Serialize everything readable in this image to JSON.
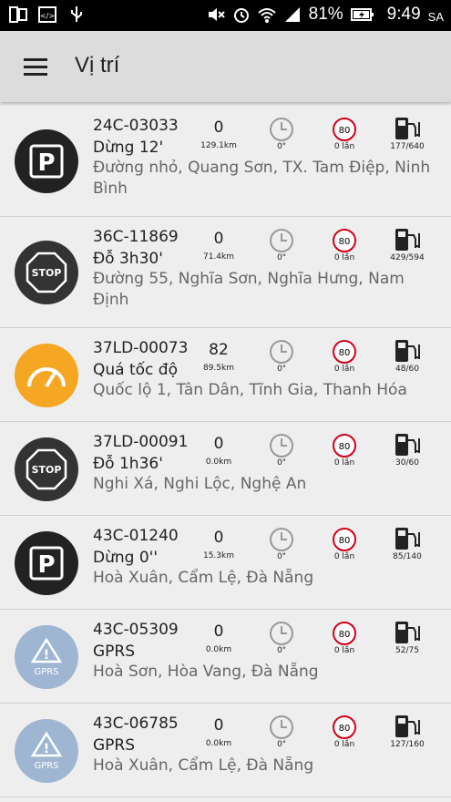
{
  "statusbar": {
    "battery": "81%",
    "time": "9:49",
    "ampm": "SA"
  },
  "appbar": {
    "title": "Vị trí"
  },
  "rows": [
    {
      "plate": "24C-03033",
      "status": "Dừng 12'",
      "address": "Đường nhỏ, Quang Sơn, TX. Tam Điệp, Ninh Bình",
      "speed": "0",
      "distance": "129.1km",
      "duration": "0\"",
      "violations": "0 lần",
      "fuel": "177/640",
      "limit": "80",
      "icon": "parking-icon"
    },
    {
      "plate": "36C-11869",
      "status": "Đỗ 3h30'",
      "address": "Đường 55, Nghĩa Sơn, Nghĩa Hưng, Nam Định",
      "speed": "0",
      "distance": "71.4km",
      "duration": "0\"",
      "violations": "0 lần",
      "fuel": "429/594",
      "limit": "80",
      "icon": "stop-icon"
    },
    {
      "plate": "37LD-00073",
      "status": "Quá tốc độ",
      "address": "Quốc lộ 1, Tân Dân, Tĩnh Gia, Thanh Hóa",
      "speed": "82",
      "distance": "89.5km",
      "duration": "0\"",
      "violations": "0 lần",
      "fuel": "48/60",
      "limit": "80",
      "icon": "speedometer-icon"
    },
    {
      "plate": "37LD-00091",
      "status": "Đỗ 1h36'",
      "address": "Nghi Xá, Nghi Lộc, Nghệ An",
      "speed": "0",
      "distance": "0.0km",
      "duration": "0\"",
      "violations": "0 lần",
      "fuel": "30/60",
      "limit": "80",
      "icon": "stop-icon"
    },
    {
      "plate": "43C-01240",
      "status": "Dừng 0''",
      "address": "Hoà Xuân, Cẩm Lệ, Đà Nẵng",
      "speed": "0",
      "distance": "15.3km",
      "duration": "0\"",
      "violations": "0 lần",
      "fuel": "85/140",
      "limit": "80",
      "icon": "parking-icon"
    },
    {
      "plate": "43C-05309",
      "status": "GPRS",
      "address": "Hoà Sơn, Hòa Vang, Đà Nẵng",
      "speed": "0",
      "distance": "0.0km",
      "duration": "0\"",
      "violations": "0 lần",
      "fuel": "52/75",
      "limit": "80",
      "icon": "gprs-warning-icon",
      "icon_label": "GPRS"
    },
    {
      "plate": "43C-06785",
      "status": "GPRS",
      "address": "Hoà Xuân, Cẩm Lệ, Đà Nẵng",
      "speed": "0",
      "distance": "0.0km",
      "duration": "0\"",
      "violations": "0 lần",
      "fuel": "127/160",
      "limit": "80",
      "icon": "gprs-warning-icon",
      "icon_label": "GPRS"
    }
  ],
  "colors": {
    "dark_avatar": "#222222",
    "speed_avatar": "#f5a623",
    "gprs_avatar": "#9fb6d3",
    "limit_ring": "#d0021b"
  }
}
